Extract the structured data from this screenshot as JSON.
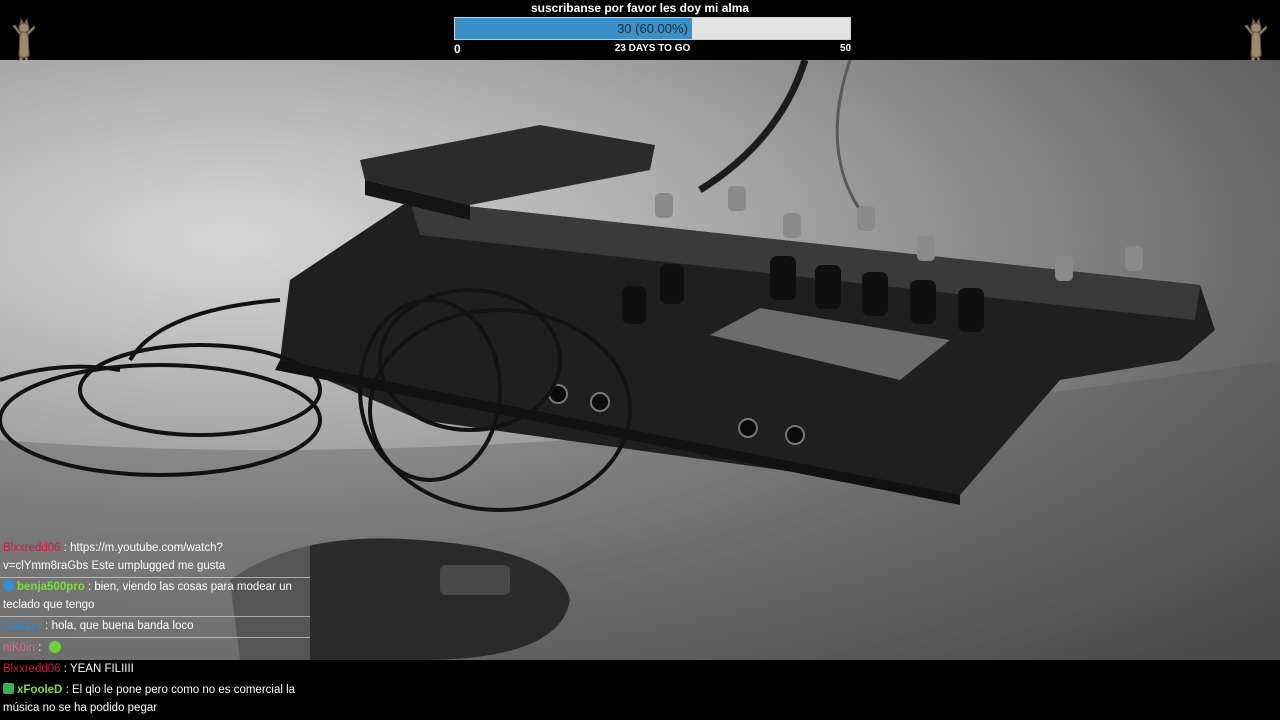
{
  "goal": {
    "title": "suscribanse por favor les doy mi alma",
    "current_label": "30 (60.00%)",
    "progress": 0.6,
    "min": "0",
    "max": "50",
    "days_left": "23 DAYS TO GO",
    "fill_color": "#3a90c8"
  },
  "icons": {
    "left_mascot": "dancing-cat-icon",
    "right_mascot": "dancing-cat-icon"
  },
  "chat_overlay": [
    {
      "user": "Blxxredd06",
      "sep": " : ",
      "text_line1": "https://m.youtube.com/watch?",
      "text_line2": "v=clYmm8raGbs Este umplugged me gusta"
    },
    {
      "user": "benja500pro",
      "sep": " : ",
      "text_line1": "bien, viendo las cosas para modear un",
      "text_line2": "teclado que tengo"
    },
    {
      "user": "Calzzer",
      "sep": " : ",
      "text": "hola, que buena banda loco"
    },
    {
      "user": "niK0in",
      "sep": " : ",
      "emote": "smiley-emote"
    }
  ],
  "chat_bottom": [
    {
      "user": "Blxxredd06",
      "sep": " : ",
      "text": "YEAN FILIIII"
    },
    {
      "user": "xFooleD",
      "sep": " : ",
      "text_line1": "El qlo le pone pero como no es comercial la",
      "text_line2": "música no se ha podido pegar"
    }
  ]
}
